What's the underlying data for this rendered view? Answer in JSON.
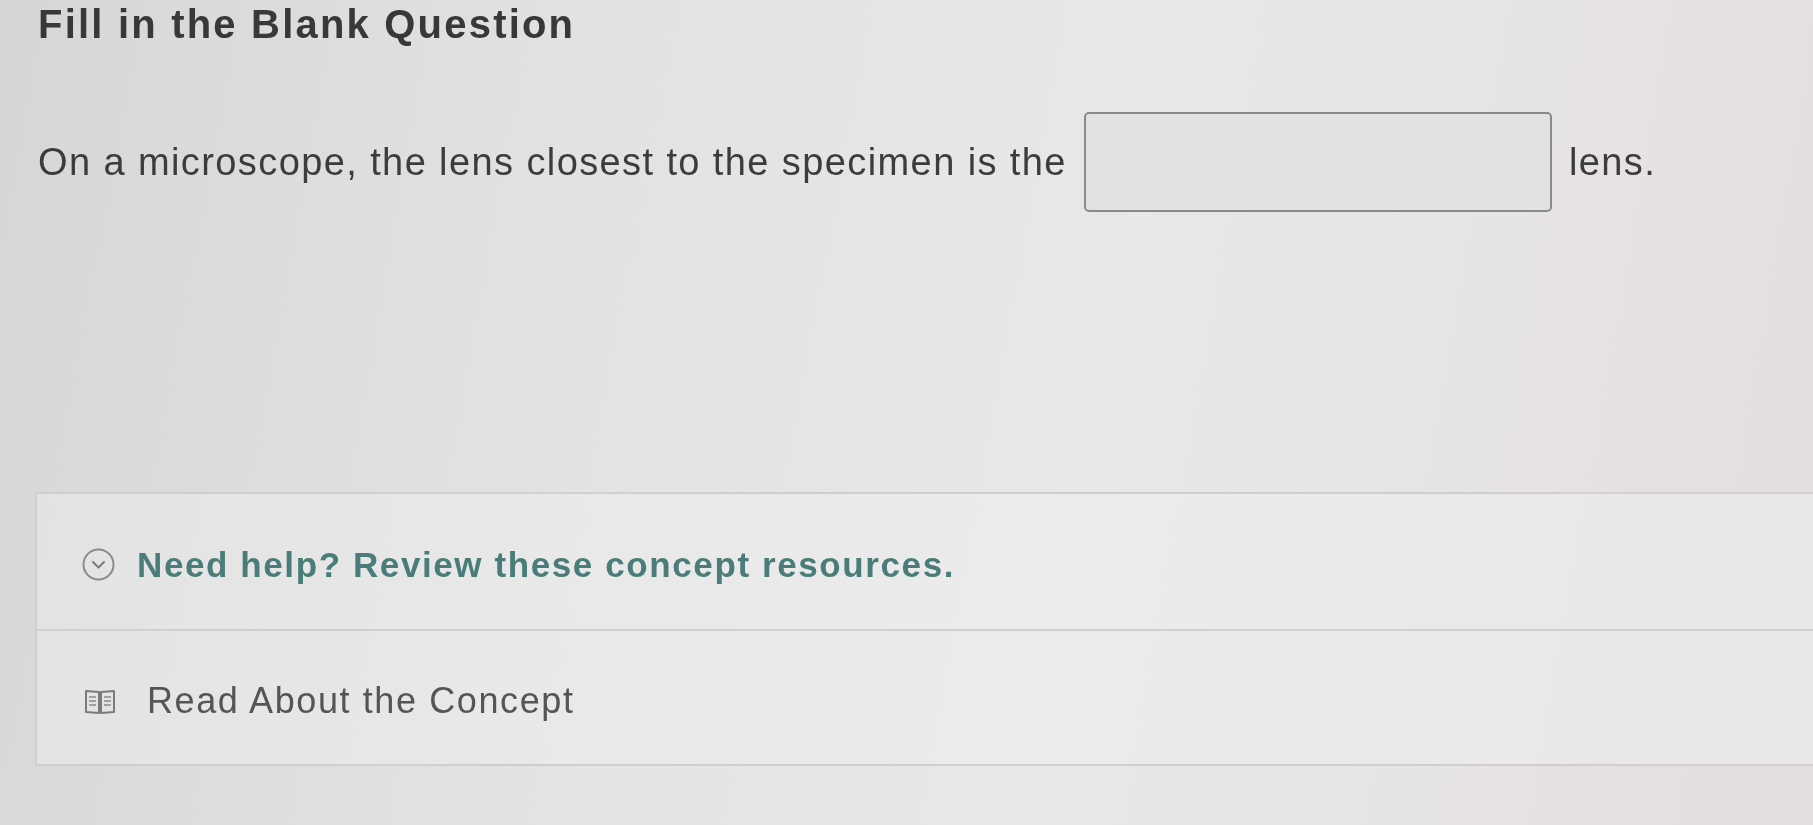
{
  "title": "Fill in the Blank Question",
  "question": {
    "segments": [
      {
        "kind": "text",
        "text": "On a microscope, the lens closest to the specimen is the"
      },
      {
        "kind": "blank"
      },
      {
        "kind": "text",
        "text": "lens."
      }
    ]
  },
  "help": {
    "heading": "Need help? Review these concept resources.",
    "resources": [
      {
        "kind": "reading",
        "label": "Read About the Concept"
      }
    ]
  }
}
